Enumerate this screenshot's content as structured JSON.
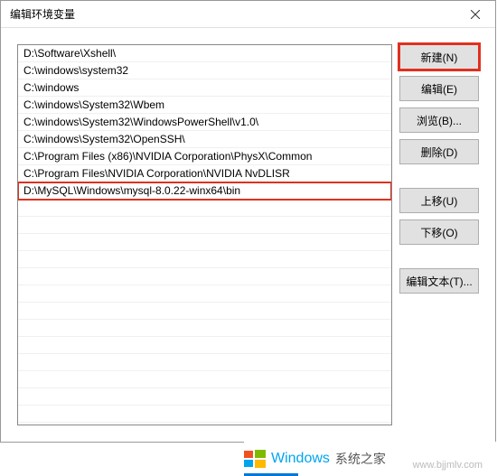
{
  "dialog": {
    "title": "编辑环境变量"
  },
  "list": {
    "items": [
      "D:\\Software\\Xshell\\",
      "C:\\windows\\system32",
      "C:\\windows",
      "C:\\windows\\System32\\Wbem",
      "C:\\windows\\System32\\WindowsPowerShell\\v1.0\\",
      "C:\\windows\\System32\\OpenSSH\\",
      "C:\\Program Files (x86)\\NVIDIA Corporation\\PhysX\\Common",
      "C:\\Program Files\\NVIDIA Corporation\\NVIDIA NvDLISR",
      "D:\\MySQL\\Windows\\mysql-8.0.22-winx64\\bin"
    ],
    "highlighted_index": 8
  },
  "buttons": {
    "new": "新建(N)",
    "edit": "编辑(E)",
    "browse": "浏览(B)...",
    "delete": "删除(D)",
    "moveup": "上移(U)",
    "movedown": "下移(O)",
    "edittext": "编辑文本(T)..."
  },
  "branding": {
    "windows": "Windows",
    "suffix": "系统之家",
    "url": "www.bjjmlv.com"
  }
}
